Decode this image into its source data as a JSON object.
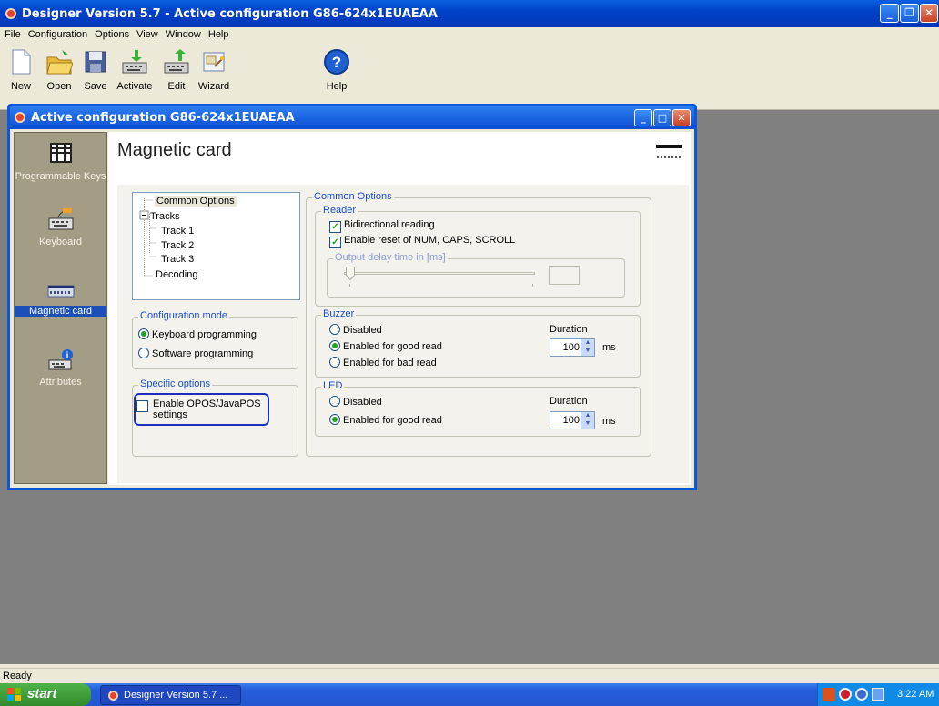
{
  "app": {
    "title": "Designer Version 5.7 - Active configuration G86-624x1EUAEAA"
  },
  "menu": [
    "File",
    "Configuration",
    "Options",
    "View",
    "Window",
    "Help"
  ],
  "toolbar": [
    {
      "label": "New",
      "icon": "new-document-icon"
    },
    {
      "label": "Open",
      "icon": "open-folder-icon"
    },
    {
      "label": "Save",
      "icon": "save-disk-icon"
    },
    {
      "label": "Activate",
      "icon": "activate-keyboard-icon"
    },
    {
      "label": "Edit",
      "icon": "edit-keyboard-icon"
    },
    {
      "label": "Wizard",
      "icon": "wizard-icon"
    },
    {
      "label": "Help",
      "icon": "help-icon"
    }
  ],
  "child": {
    "title": "Active configuration G86-624x1EUAEAA"
  },
  "sidebar": [
    {
      "label": "Programmable Keys",
      "icon": "programmable-keys-icon"
    },
    {
      "label": "Keyboard",
      "icon": "keyboard-icon"
    },
    {
      "label": "Magnetic card",
      "icon": "magnetic-card-icon",
      "selected": true
    },
    {
      "label": "Attributes",
      "icon": "attributes-icon"
    }
  ],
  "page": {
    "title": "Magnetic card"
  },
  "tree": {
    "common": "Common Options",
    "tracks": "Tracks",
    "track1": "Track 1",
    "track2": "Track 2",
    "track3": "Track 3",
    "decoding": "Decoding",
    "selected": "Common Options"
  },
  "config_mode": {
    "title": "Configuration mode",
    "keyboard": "Keyboard programming",
    "software": "Software programming",
    "selected": "Keyboard programming"
  },
  "specific": {
    "title": "Specific options",
    "opos": "Enable OPOS/JavaPOS settings",
    "opos_checked": false
  },
  "common": {
    "title": "Common Options"
  },
  "reader": {
    "title": "Reader",
    "bidirectional": "Bidirectional reading",
    "bidirectional_checked": true,
    "reset": "Enable reset of NUM, CAPS, SCROLL",
    "reset_checked": true,
    "delay_title": "Output delay time in [ms]",
    "delay_value": ""
  },
  "buzzer": {
    "title": "Buzzer",
    "disabled": "Disabled",
    "good": "Enabled for good read",
    "bad": "Enabled for bad read",
    "selected": "Enabled for good read",
    "duration_label": "Duration",
    "duration": "100",
    "unit": "ms"
  },
  "led": {
    "title": "LED",
    "disabled": "Disabled",
    "good": "Enabled for good read",
    "selected": "Enabled for good read",
    "duration_label": "Duration",
    "duration": "100",
    "unit": "ms"
  },
  "status": {
    "text": "Ready"
  },
  "taskbar": {
    "start": "start",
    "task": "Designer Version 5.7 ...",
    "clock": "3:22 AM"
  }
}
